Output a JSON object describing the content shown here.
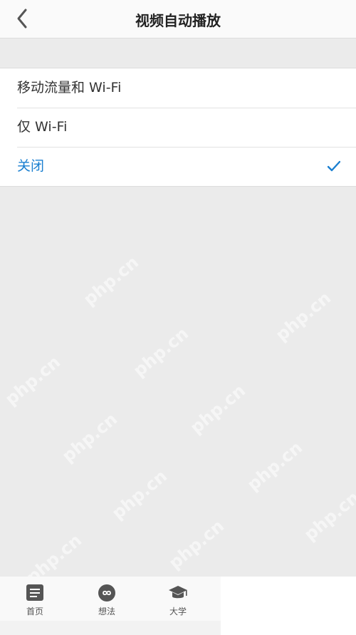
{
  "header": {
    "title": "视频自动播放",
    "back_icon": "chevron-left-icon"
  },
  "options": [
    {
      "label": "移动流量和 Wi-Fi",
      "selected": false
    },
    {
      "label": "仅 Wi-Fi",
      "selected": false
    },
    {
      "label": "关闭",
      "selected": true
    }
  ],
  "tabs": [
    {
      "label": "首页",
      "icon": "document-icon"
    },
    {
      "label": "想法",
      "icon": "infinity-icon"
    },
    {
      "label": "大学",
      "icon": "graduation-cap-icon"
    }
  ],
  "colors": {
    "accent": "#1a7fd0",
    "background": "#ebebeb",
    "tab_icon": "#555555"
  },
  "watermark": "php.cn"
}
